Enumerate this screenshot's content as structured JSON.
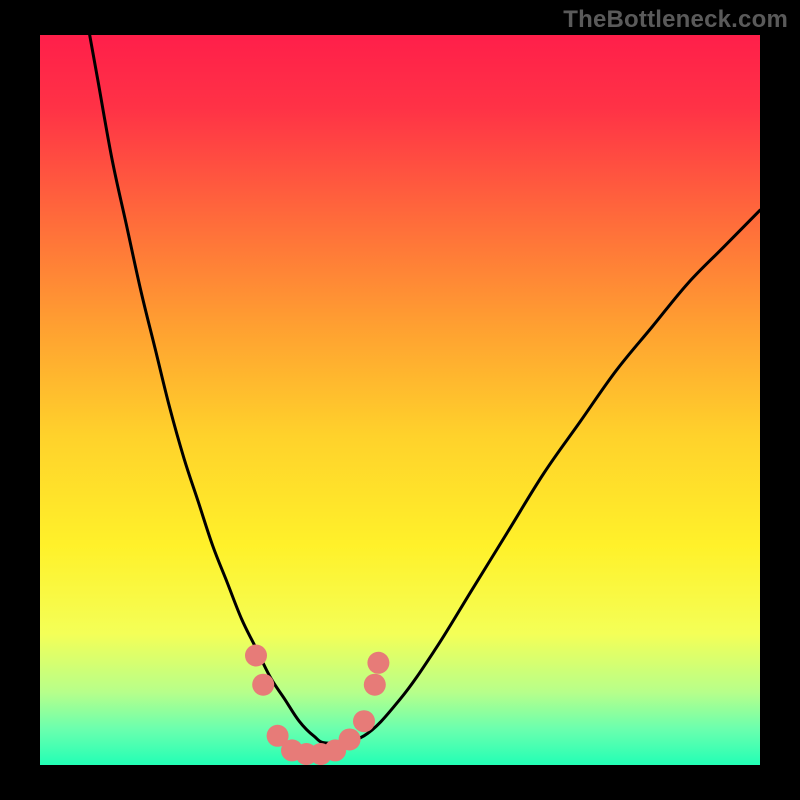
{
  "watermark": "TheBottleneck.com",
  "colors": {
    "frame": "#000000",
    "curve": "#000000",
    "dot": "#e77b78",
    "gradient_stops": [
      {
        "offset": 0.0,
        "color": "#ff1f4a"
      },
      {
        "offset": 0.1,
        "color": "#ff3246"
      },
      {
        "offset": 0.25,
        "color": "#ff6a3b"
      },
      {
        "offset": 0.4,
        "color": "#ffa031"
      },
      {
        "offset": 0.55,
        "color": "#ffd22b"
      },
      {
        "offset": 0.7,
        "color": "#fff12a"
      },
      {
        "offset": 0.82,
        "color": "#f4ff57"
      },
      {
        "offset": 0.9,
        "color": "#b7ff8a"
      },
      {
        "offset": 0.95,
        "color": "#6cffae"
      },
      {
        "offset": 1.0,
        "color": "#22ffb5"
      }
    ]
  },
  "chart_data": {
    "type": "line",
    "title": "",
    "xlabel": "",
    "ylabel": "",
    "xlim": [
      0,
      100
    ],
    "ylim": [
      0,
      100
    ],
    "series": [
      {
        "name": "bottleneck-curve",
        "x": [
          6.9,
          8,
          10,
          12,
          14,
          16,
          18,
          20,
          22,
          24,
          26,
          28,
          30,
          32,
          34,
          36,
          38,
          40,
          45,
          50,
          55,
          60,
          65,
          70,
          75,
          80,
          85,
          90,
          95,
          100
        ],
        "values": [
          100,
          94,
          83,
          74,
          65,
          57,
          49,
          42,
          36,
          30,
          25,
          20,
          16,
          12,
          9,
          6,
          4,
          3,
          4,
          9,
          16,
          24,
          32,
          40,
          47,
          54,
          60,
          66,
          71,
          76
        ]
      }
    ],
    "dots": [
      {
        "x": 30,
        "y": 15
      },
      {
        "x": 31,
        "y": 11
      },
      {
        "x": 33,
        "y": 4
      },
      {
        "x": 35,
        "y": 2
      },
      {
        "x": 37,
        "y": 1.5
      },
      {
        "x": 39,
        "y": 1.5
      },
      {
        "x": 41,
        "y": 2
      },
      {
        "x": 43,
        "y": 3.5
      },
      {
        "x": 45,
        "y": 6
      },
      {
        "x": 46.5,
        "y": 11
      },
      {
        "x": 47,
        "y": 14
      }
    ]
  }
}
